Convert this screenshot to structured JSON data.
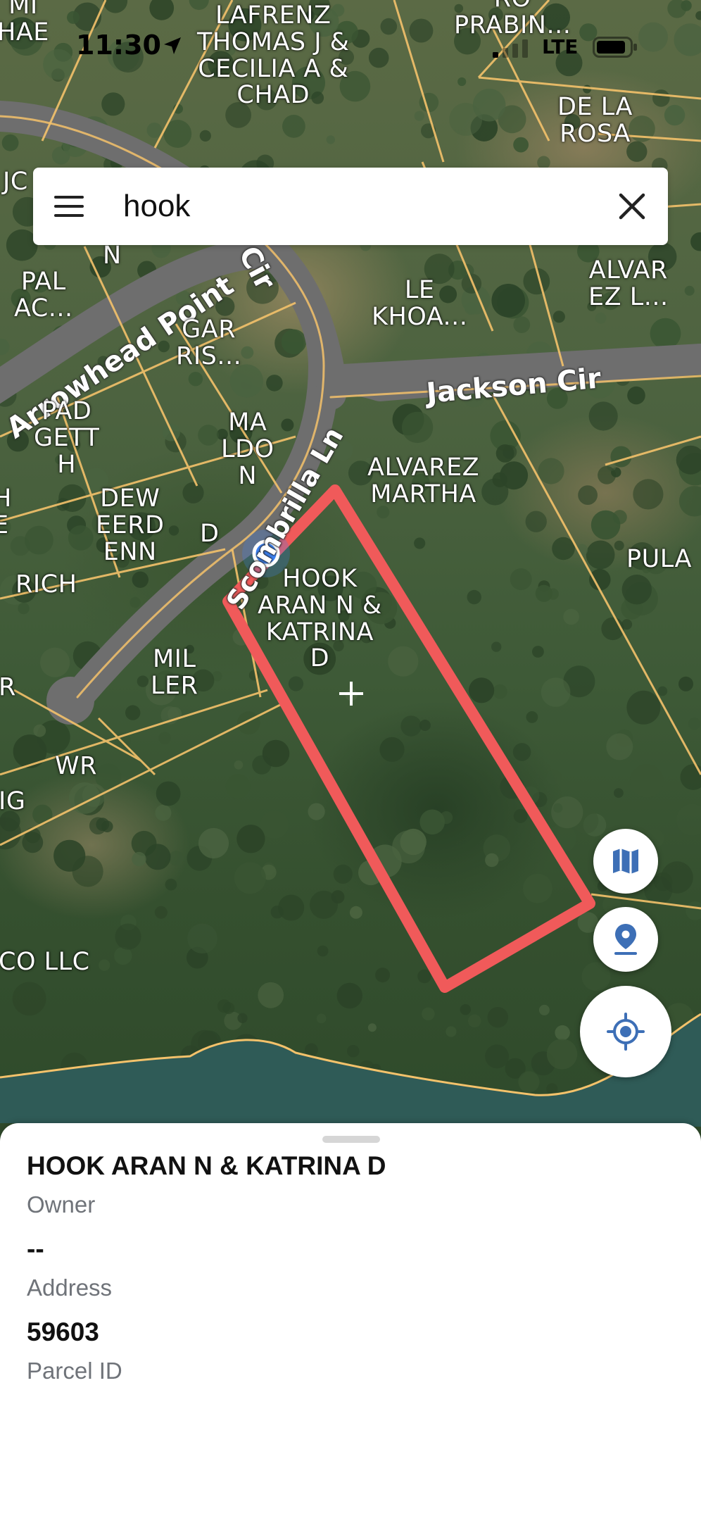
{
  "status_bar": {
    "time": "11:30",
    "network": "LTE",
    "icons": [
      "location-arrow-icon",
      "signal-icon",
      "battery-icon"
    ]
  },
  "search": {
    "query": "hook",
    "menu_icon": "menu-icon",
    "clear_icon": "close-icon"
  },
  "map": {
    "type": "satellite",
    "parcel_line_color": "#f4c26b",
    "selected_parcel_color": "#f05a5a",
    "user_location_color": "#3b82f6",
    "roads": [
      {
        "name": "Arrowhead Point"
      },
      {
        "name": "Jackson Cir"
      },
      {
        "name": "Scombrilla Ln"
      },
      {
        "name": "Cir"
      }
    ],
    "parcel_labels": [
      "MI\nHAE",
      "LAFRENZ\nTHOMAS J &\nCECILIA A &\nCHAD",
      "RO\nPRABIN...",
      "DE LA\nROSA",
      "JC",
      "N",
      "PAL\nAC...",
      "GAR\nRIS...",
      "LE\nKHOA...",
      "ALVAR\nEZ L...",
      "PAD\nGETT\nH",
      "MA\nLDO\nN",
      "ALVAREZ\nMARTHA",
      "H\nE",
      "DEW\nEERD\nENN",
      "D",
      "PULA",
      "RICH",
      "HOOK\nARAN N &\nKATRINA\nD",
      "MIL\nLER",
      "R",
      "WR",
      "IG",
      "CO LLC"
    ]
  },
  "controls": {
    "map_type_icon": "map-icon",
    "pin_icon": "map-pin-icon",
    "locate_icon": "my-location-icon",
    "accent": "#3d6fb6"
  },
  "parcel": {
    "owner_value": "HOOK ARAN N & KATRINA D",
    "owner_label": "Owner",
    "address_value": "--",
    "address_label": "Address",
    "parcel_id_value": "59603",
    "parcel_id_label": "Parcel ID"
  }
}
